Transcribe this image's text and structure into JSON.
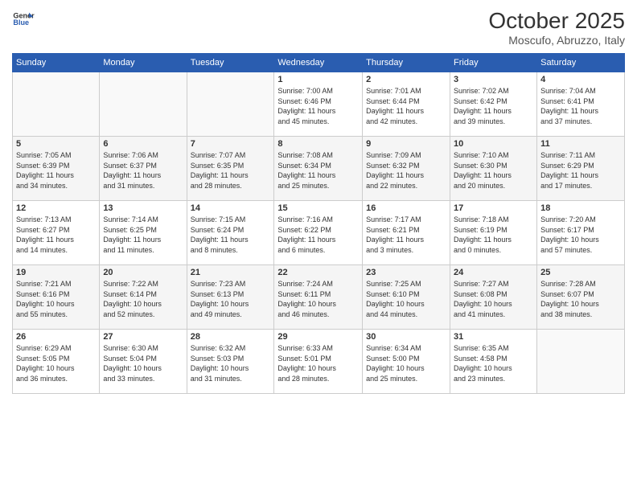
{
  "header": {
    "logo_line1": "General",
    "logo_line2": "Blue",
    "month": "October 2025",
    "location": "Moscufo, Abruzzo, Italy"
  },
  "weekdays": [
    "Sunday",
    "Monday",
    "Tuesday",
    "Wednesday",
    "Thursday",
    "Friday",
    "Saturday"
  ],
  "weeks": [
    [
      {
        "day": "",
        "info": ""
      },
      {
        "day": "",
        "info": ""
      },
      {
        "day": "",
        "info": ""
      },
      {
        "day": "1",
        "info": "Sunrise: 7:00 AM\nSunset: 6:46 PM\nDaylight: 11 hours\nand 45 minutes."
      },
      {
        "day": "2",
        "info": "Sunrise: 7:01 AM\nSunset: 6:44 PM\nDaylight: 11 hours\nand 42 minutes."
      },
      {
        "day": "3",
        "info": "Sunrise: 7:02 AM\nSunset: 6:42 PM\nDaylight: 11 hours\nand 39 minutes."
      },
      {
        "day": "4",
        "info": "Sunrise: 7:04 AM\nSunset: 6:41 PM\nDaylight: 11 hours\nand 37 minutes."
      }
    ],
    [
      {
        "day": "5",
        "info": "Sunrise: 7:05 AM\nSunset: 6:39 PM\nDaylight: 11 hours\nand 34 minutes."
      },
      {
        "day": "6",
        "info": "Sunrise: 7:06 AM\nSunset: 6:37 PM\nDaylight: 11 hours\nand 31 minutes."
      },
      {
        "day": "7",
        "info": "Sunrise: 7:07 AM\nSunset: 6:35 PM\nDaylight: 11 hours\nand 28 minutes."
      },
      {
        "day": "8",
        "info": "Sunrise: 7:08 AM\nSunset: 6:34 PM\nDaylight: 11 hours\nand 25 minutes."
      },
      {
        "day": "9",
        "info": "Sunrise: 7:09 AM\nSunset: 6:32 PM\nDaylight: 11 hours\nand 22 minutes."
      },
      {
        "day": "10",
        "info": "Sunrise: 7:10 AM\nSunset: 6:30 PM\nDaylight: 11 hours\nand 20 minutes."
      },
      {
        "day": "11",
        "info": "Sunrise: 7:11 AM\nSunset: 6:29 PM\nDaylight: 11 hours\nand 17 minutes."
      }
    ],
    [
      {
        "day": "12",
        "info": "Sunrise: 7:13 AM\nSunset: 6:27 PM\nDaylight: 11 hours\nand 14 minutes."
      },
      {
        "day": "13",
        "info": "Sunrise: 7:14 AM\nSunset: 6:25 PM\nDaylight: 11 hours\nand 11 minutes."
      },
      {
        "day": "14",
        "info": "Sunrise: 7:15 AM\nSunset: 6:24 PM\nDaylight: 11 hours\nand 8 minutes."
      },
      {
        "day": "15",
        "info": "Sunrise: 7:16 AM\nSunset: 6:22 PM\nDaylight: 11 hours\nand 6 minutes."
      },
      {
        "day": "16",
        "info": "Sunrise: 7:17 AM\nSunset: 6:21 PM\nDaylight: 11 hours\nand 3 minutes."
      },
      {
        "day": "17",
        "info": "Sunrise: 7:18 AM\nSunset: 6:19 PM\nDaylight: 11 hours\nand 0 minutes."
      },
      {
        "day": "18",
        "info": "Sunrise: 7:20 AM\nSunset: 6:17 PM\nDaylight: 10 hours\nand 57 minutes."
      }
    ],
    [
      {
        "day": "19",
        "info": "Sunrise: 7:21 AM\nSunset: 6:16 PM\nDaylight: 10 hours\nand 55 minutes."
      },
      {
        "day": "20",
        "info": "Sunrise: 7:22 AM\nSunset: 6:14 PM\nDaylight: 10 hours\nand 52 minutes."
      },
      {
        "day": "21",
        "info": "Sunrise: 7:23 AM\nSunset: 6:13 PM\nDaylight: 10 hours\nand 49 minutes."
      },
      {
        "day": "22",
        "info": "Sunrise: 7:24 AM\nSunset: 6:11 PM\nDaylight: 10 hours\nand 46 minutes."
      },
      {
        "day": "23",
        "info": "Sunrise: 7:25 AM\nSunset: 6:10 PM\nDaylight: 10 hours\nand 44 minutes."
      },
      {
        "day": "24",
        "info": "Sunrise: 7:27 AM\nSunset: 6:08 PM\nDaylight: 10 hours\nand 41 minutes."
      },
      {
        "day": "25",
        "info": "Sunrise: 7:28 AM\nSunset: 6:07 PM\nDaylight: 10 hours\nand 38 minutes."
      }
    ],
    [
      {
        "day": "26",
        "info": "Sunrise: 6:29 AM\nSunset: 5:05 PM\nDaylight: 10 hours\nand 36 minutes."
      },
      {
        "day": "27",
        "info": "Sunrise: 6:30 AM\nSunset: 5:04 PM\nDaylight: 10 hours\nand 33 minutes."
      },
      {
        "day": "28",
        "info": "Sunrise: 6:32 AM\nSunset: 5:03 PM\nDaylight: 10 hours\nand 31 minutes."
      },
      {
        "day": "29",
        "info": "Sunrise: 6:33 AM\nSunset: 5:01 PM\nDaylight: 10 hours\nand 28 minutes."
      },
      {
        "day": "30",
        "info": "Sunrise: 6:34 AM\nSunset: 5:00 PM\nDaylight: 10 hours\nand 25 minutes."
      },
      {
        "day": "31",
        "info": "Sunrise: 6:35 AM\nSunset: 4:58 PM\nDaylight: 10 hours\nand 23 minutes."
      },
      {
        "day": "",
        "info": ""
      }
    ]
  ]
}
